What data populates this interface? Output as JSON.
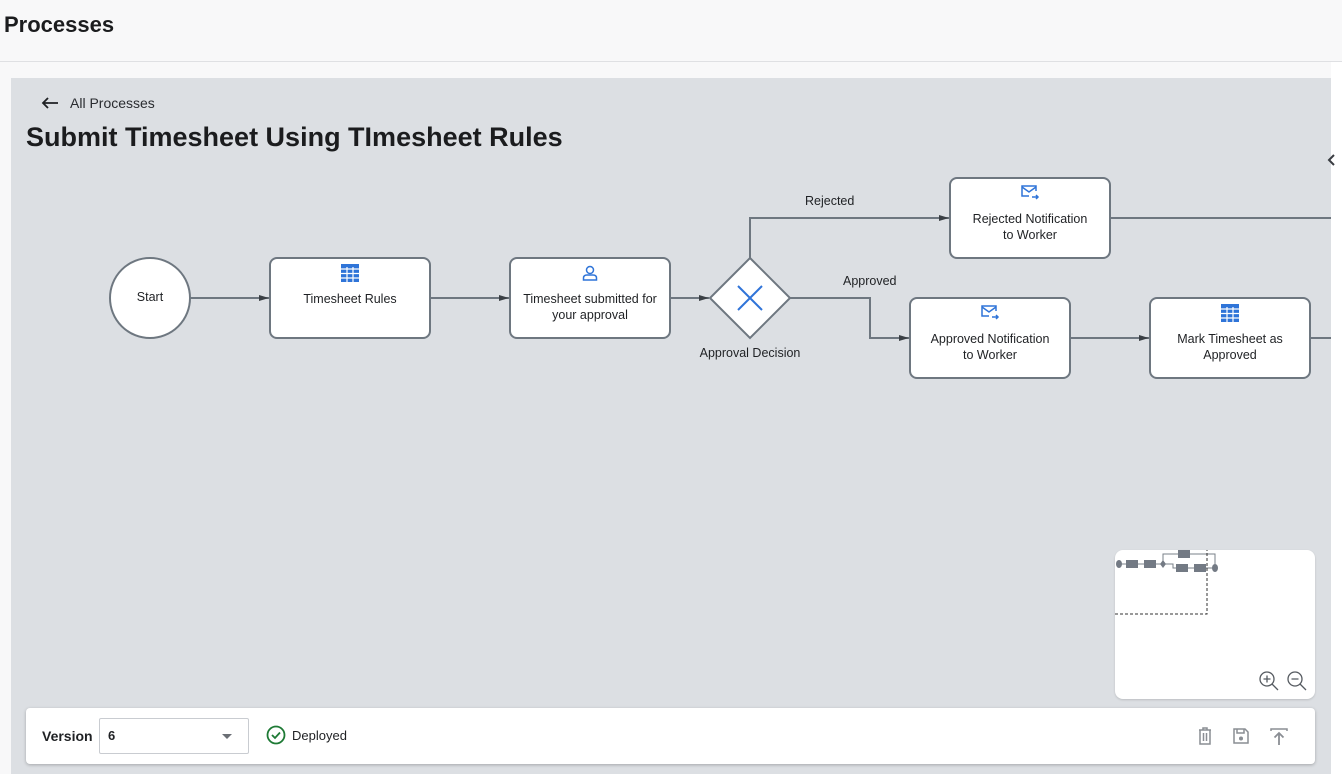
{
  "page": {
    "title": "Processes"
  },
  "breadcrumb": {
    "back_label": "All Processes",
    "icon": "arrow-left-icon"
  },
  "process": {
    "title": "Submit Timesheet Using TImesheet Rules"
  },
  "diagram": {
    "nodes": {
      "start": {
        "label": "Start",
        "type": "start-event"
      },
      "timesheet_rules": {
        "label": "Timesheet Rules",
        "type": "rules-task",
        "icon": "table-grid-icon"
      },
      "submitted": {
        "label_line1": "Timesheet submitted for",
        "label_line2": "your approval",
        "type": "user-task",
        "icon": "person-icon"
      },
      "decision": {
        "label": "Approval Decision",
        "type": "exclusive-gateway",
        "icon": "x-icon"
      },
      "rejected_notification": {
        "label_line1": "Rejected Notification",
        "label_line2": "to Worker",
        "type": "email-task",
        "icon": "mail-send-icon"
      },
      "approved_notification": {
        "label_line1": "Approved Notification",
        "label_line2": "to Worker",
        "type": "email-task",
        "icon": "mail-send-icon"
      },
      "mark_approved": {
        "label_line1": "Mark Timesheet as",
        "label_line2": "Approved",
        "type": "rules-task",
        "icon": "table-grid-icon"
      }
    },
    "edges": {
      "rejected": {
        "label": "Rejected"
      },
      "approved": {
        "label": "Approved"
      }
    }
  },
  "minimap": {
    "zoom_in": "zoom-in-icon",
    "zoom_out": "zoom-out-icon"
  },
  "footer": {
    "version_label": "Version",
    "version_value": "6",
    "status": "Deployed",
    "actions": [
      "delete",
      "save",
      "deploy"
    ]
  },
  "colors": {
    "accent": "#2f74d8",
    "edge": "#6e7780",
    "canvas": "#dcdfe3",
    "deployed": "#1e7a35"
  }
}
